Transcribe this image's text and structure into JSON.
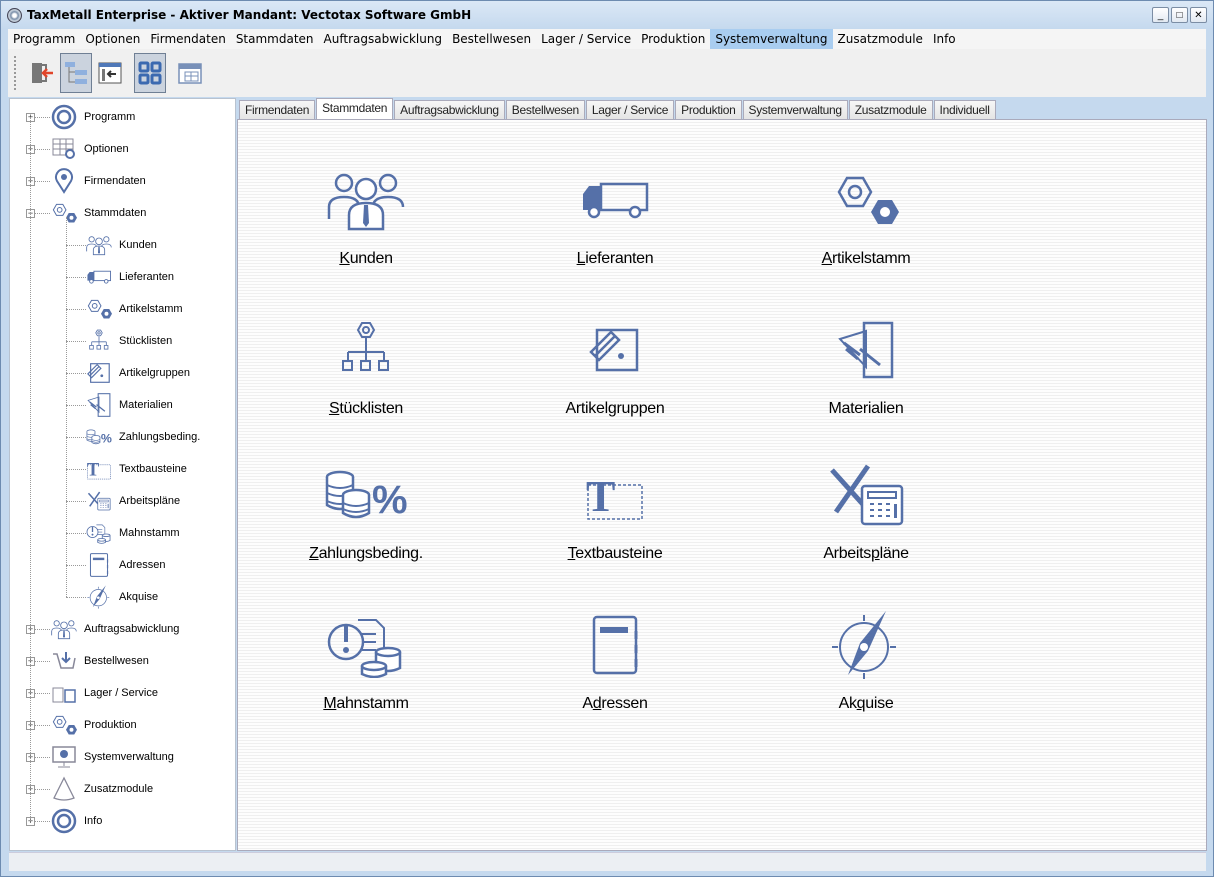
{
  "window": {
    "title": "TaxMetall Enterprise - Aktiver Mandant: Vectotax Software GmbH",
    "minimize": "_",
    "maximize": "□",
    "close": "✕"
  },
  "menu": [
    "Programm",
    "Optionen",
    "Firmendaten",
    "Stammdaten",
    "Auftragsabwicklung",
    "Bestellwesen",
    "Lager / Service",
    "Produktion",
    "Systemverwaltung",
    "Zusatzmodule",
    "Info"
  ],
  "menu_active": "Systemverwaltung",
  "toolbar": [
    "exit-icon",
    "tree-view-icon",
    "back-panel-icon",
    "tile-view-icon",
    "calendar-icon"
  ],
  "tree": {
    "top": [
      "Programm",
      "Optionen",
      "Firmendaten",
      "Stammdaten"
    ],
    "children": [
      "Kunden",
      "Lieferanten",
      "Artikelstamm",
      "Stücklisten",
      "Artikelgruppen",
      "Materialien",
      "Zahlungsbeding.",
      "Textbausteine",
      "Arbeitspläne",
      "Mahnstamm",
      "Adressen",
      "Akquise"
    ],
    "bottom": [
      "Auftragsabwicklung",
      "Bestellwesen",
      "Lager / Service",
      "Produktion",
      "Systemverwaltung",
      "Zusatzmodule",
      "Info"
    ]
  },
  "tabs": [
    "Firmendaten",
    "Stammdaten",
    "Auftragsabwicklung",
    "Bestellwesen",
    "Lager / Service",
    "Produktion",
    "Systemverwaltung",
    "Zusatzmodule",
    "Individuell"
  ],
  "active_tab": "Stammdaten",
  "tiles": [
    {
      "pre": "",
      "key": "K",
      "post": "unden",
      "icon": "people"
    },
    {
      "pre": "",
      "key": "L",
      "post": "ieferanten",
      "icon": "truck"
    },
    {
      "pre": "",
      "key": "A",
      "post": "rtikelstamm",
      "icon": "nuts"
    },
    {
      "pre": "",
      "key": "S",
      "post": "tücklisten",
      "icon": "hierarchy"
    },
    {
      "pre": "Artikel",
      "key": "g",
      "post": "ruppen",
      "icon": "swatch"
    },
    {
      "pre": "Materialien",
      "key": "",
      "post": "",
      "icon": "material"
    },
    {
      "pre": "",
      "key": "Z",
      "post": "ahlungsbeding.",
      "icon": "coins-percent"
    },
    {
      "pre": "",
      "key": "T",
      "post": "extbausteine",
      "icon": "text"
    },
    {
      "pre": "Arbeits",
      "key": "p",
      "post": "läne",
      "icon": "tools-calc"
    },
    {
      "pre": "",
      "key": "M",
      "post": "ahnstamm",
      "icon": "warning-doc"
    },
    {
      "pre": "A",
      "key": "d",
      "post": "ressen",
      "icon": "address-book"
    },
    {
      "pre": "Ak",
      "key": "q",
      "post": "uise",
      "icon": "compass"
    }
  ],
  "colors": {
    "icon": "#5570a8",
    "menu_active": "#a9cdf0"
  }
}
